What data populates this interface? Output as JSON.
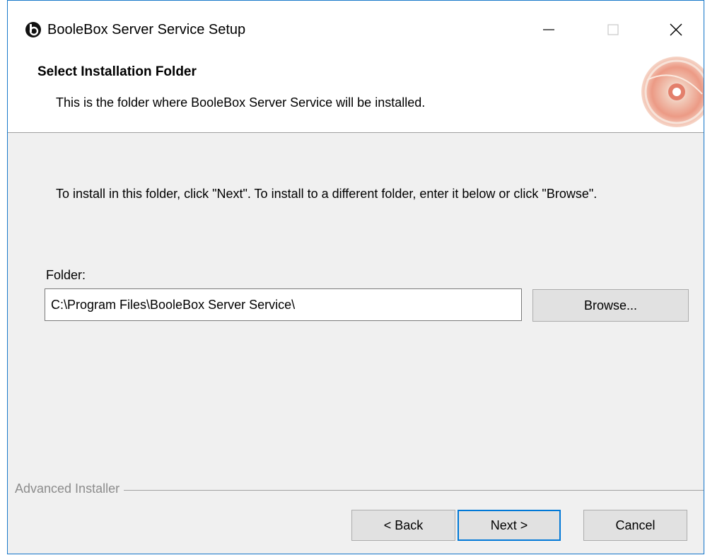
{
  "window": {
    "title": "BooleBox Server Service Setup"
  },
  "header": {
    "title": "Select Installation Folder",
    "subtitle": "This is the folder where BooleBox Server Service will be installed."
  },
  "body": {
    "instructions": "To install in this folder, click \"Next\". To install to a different folder, enter it below or click \"Browse\".",
    "folder_label": "Folder:",
    "folder_value": "C:\\Program Files\\BooleBox Server Service\\",
    "browse_label": "Browse..."
  },
  "footer": {
    "brand": "Advanced Installer",
    "back_label": "< Back",
    "next_label": "Next >",
    "cancel_label": "Cancel"
  },
  "colors": {
    "window_border": "#1979ca",
    "dialog_background": "#f0f0f0",
    "default_button_border": "#0078d7"
  }
}
